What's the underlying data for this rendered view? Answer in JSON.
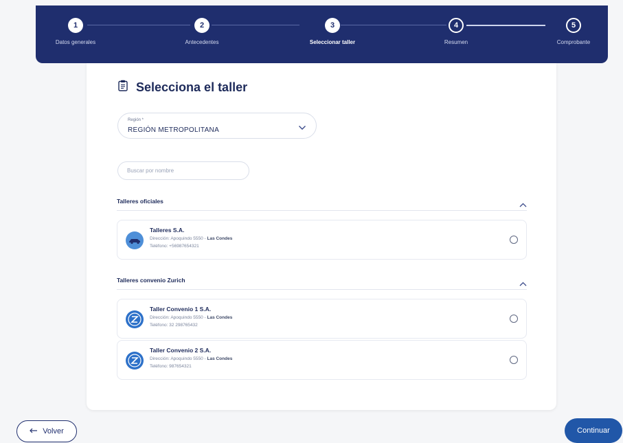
{
  "stepper": {
    "steps": [
      {
        "number": "1",
        "label": "Datos generales",
        "state": "done"
      },
      {
        "number": "2",
        "label": "Antecedentes",
        "state": "done"
      },
      {
        "number": "3",
        "label": "Seleccionar taller",
        "state": "current"
      },
      {
        "number": "4",
        "label": "Resumen",
        "state": "upcoming"
      },
      {
        "number": "5",
        "label": "Comprobante",
        "state": "upcoming"
      }
    ]
  },
  "page": {
    "title": "Selecciona el taller",
    "title_icon": "clipboard-icon"
  },
  "region_select": {
    "label": "Región *",
    "value": "REGIÓN METROPOLITANA",
    "icon": "chevron-down-icon"
  },
  "search": {
    "placeholder": "Buscar por nombre",
    "value": ""
  },
  "sections": [
    {
      "title": "Talleres oficiales",
      "expanded": true,
      "items": [
        {
          "name": "Talleres S.A.",
          "address_label": "Dirección: Apoquindo 5550 - ",
          "address_commune": "Las Condes",
          "phone": "Teléfono: +56987654321",
          "logo": "car-logo-icon",
          "selected": false
        }
      ]
    },
    {
      "title": "Talleres convenio Zurich",
      "expanded": true,
      "items": [
        {
          "name": "Taller Convenio 1 S.A.",
          "address_label": "Dirección: Apoquindo 5550 - ",
          "address_commune": "Las Condes",
          "phone": "Teléfono: 32 298765432",
          "logo": "zurich-logo-icon",
          "selected": false
        },
        {
          "name": "Taller Convenio 2 S.A.",
          "address_label": "Dirección: Apoquindo 5550 - ",
          "address_commune": "Las Condes",
          "phone": "Teléfono: 987654321",
          "logo": "zurich-logo-icon",
          "selected": false
        }
      ]
    }
  ],
  "footer": {
    "back_label": "Volver",
    "continue_label": "Continuar"
  },
  "colors": {
    "primary": "#1f2e6e",
    "accent": "#2157a8",
    "logo_blue": "#2d71c9"
  }
}
